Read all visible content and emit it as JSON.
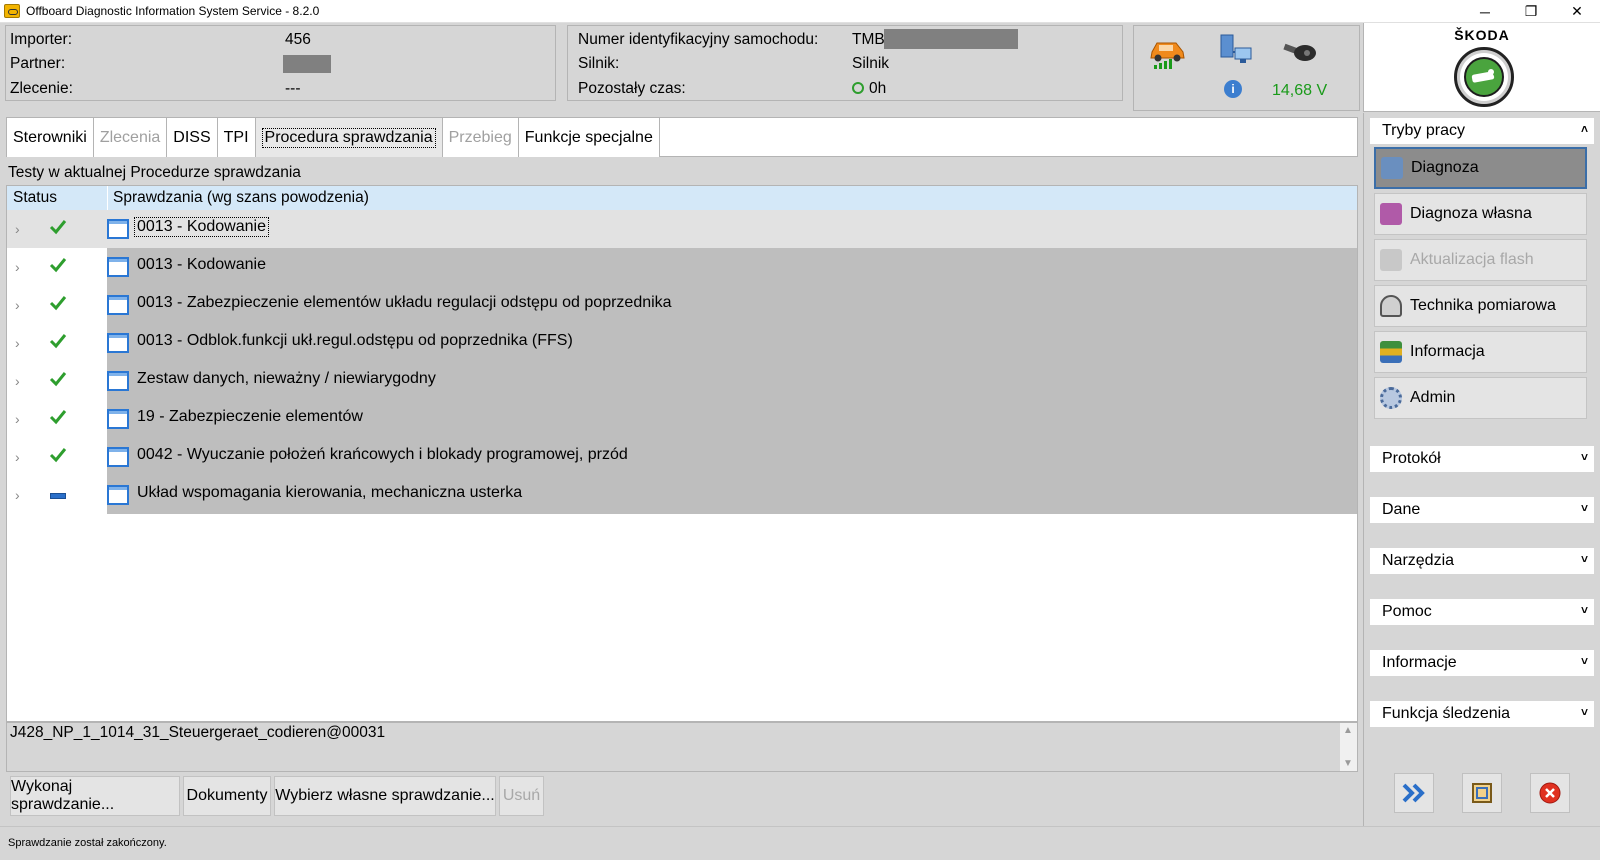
{
  "window": {
    "title": "Offboard Diagnostic Information System Service - 8.2.0",
    "minimize": "─",
    "restore": "❐",
    "close": "✕"
  },
  "info_left": {
    "importer_label": "Importer:",
    "importer_value": "456",
    "partner_label": "Partner:",
    "order_label": "Zlecenie:",
    "order_value": "---"
  },
  "info_mid": {
    "vin_label": "Numer identyfikacyjny samochodu:",
    "vin_value": "TMB",
    "engine_label": "Silnik:",
    "engine_value": "Silnik",
    "time_label": "Pozostały czas:",
    "time_value": "0h"
  },
  "status_icons": {
    "voltage": "14,68 V",
    "info_glyph": "i"
  },
  "brand": {
    "name": "ŠKODA"
  },
  "tabs": [
    {
      "label": "Sterowniki",
      "state": "normal"
    },
    {
      "label": "Zlecenia",
      "state": "disabled"
    },
    {
      "label": "DISS",
      "state": "normal"
    },
    {
      "label": "TPI",
      "state": "normal"
    },
    {
      "label": "Procedura sprawdzania",
      "state": "active"
    },
    {
      "label": "Przebieg",
      "state": "disabled"
    },
    {
      "label": "Funkcje specjalne",
      "state": "normal"
    }
  ],
  "main": {
    "section_title": "Testy w aktualnej Procedurze sprawdzania",
    "col_status": "Status",
    "col_checks": "Sprawdzania (wg szans powodzenia)",
    "rows": [
      {
        "text": "0013 - Kodowanie",
        "status": "ok"
      },
      {
        "text": "0013 - Kodowanie",
        "status": "ok"
      },
      {
        "text": "0013 - Zabezpieczenie elementów układu regulacji odstępu od poprzednika",
        "status": "ok"
      },
      {
        "text": "0013 - Odblok.funkcji ukł.regul.odstępu od poprzednika (FFS)",
        "status": "ok"
      },
      {
        "text": "Zestaw danych, nieważny / niewiarygodny",
        "status": "ok"
      },
      {
        "text": "19 - Zabezpieczenie elementów",
        "status": "ok"
      },
      {
        "text": "0042 - Wyuczanie położeń krańcowych i blokady programowej, przód",
        "status": "ok"
      },
      {
        "text": "Układ wspomagania kierowania, mechaniczna usterka",
        "status": "pending"
      }
    ],
    "chevron": "›",
    "detail_text": "J428_NP_1_1014_31_Steuergeraet_codieren@00031"
  },
  "buttons": {
    "execute": "Wykonaj sprawdzanie...",
    "documents": "Dokumenty",
    "choose_own": "Wybierz własne sprawdzanie...",
    "remove": "Usuń"
  },
  "status_bar": {
    "text": "Sprawdzanie został zakończony."
  },
  "side": {
    "modes_header": "Tryby pracy",
    "modes": [
      {
        "label": "Diagnoza",
        "state": "active"
      },
      {
        "label": "Diagnoza własna",
        "state": "normal"
      },
      {
        "label": "Aktualizacja flash",
        "state": "disabled"
      },
      {
        "label": "Technika pomiarowa",
        "state": "normal"
      },
      {
        "label": "Informacja",
        "state": "normal"
      },
      {
        "label": "Admin",
        "state": "normal"
      }
    ],
    "sections": [
      "Protokół",
      "Dane",
      "Narzędzia",
      "Pomoc",
      "Informacje",
      "Funkcja śledzenia"
    ],
    "collapse_glyph": "˄",
    "expand_glyph": "˅"
  },
  "colors": {
    "accent_green": "#2e9e2e",
    "header_blue": "#d4e8f8",
    "row_gray": "#bebebe",
    "selected_row": "#e2e2e2",
    "voltage_green": "#1a9a1a"
  }
}
